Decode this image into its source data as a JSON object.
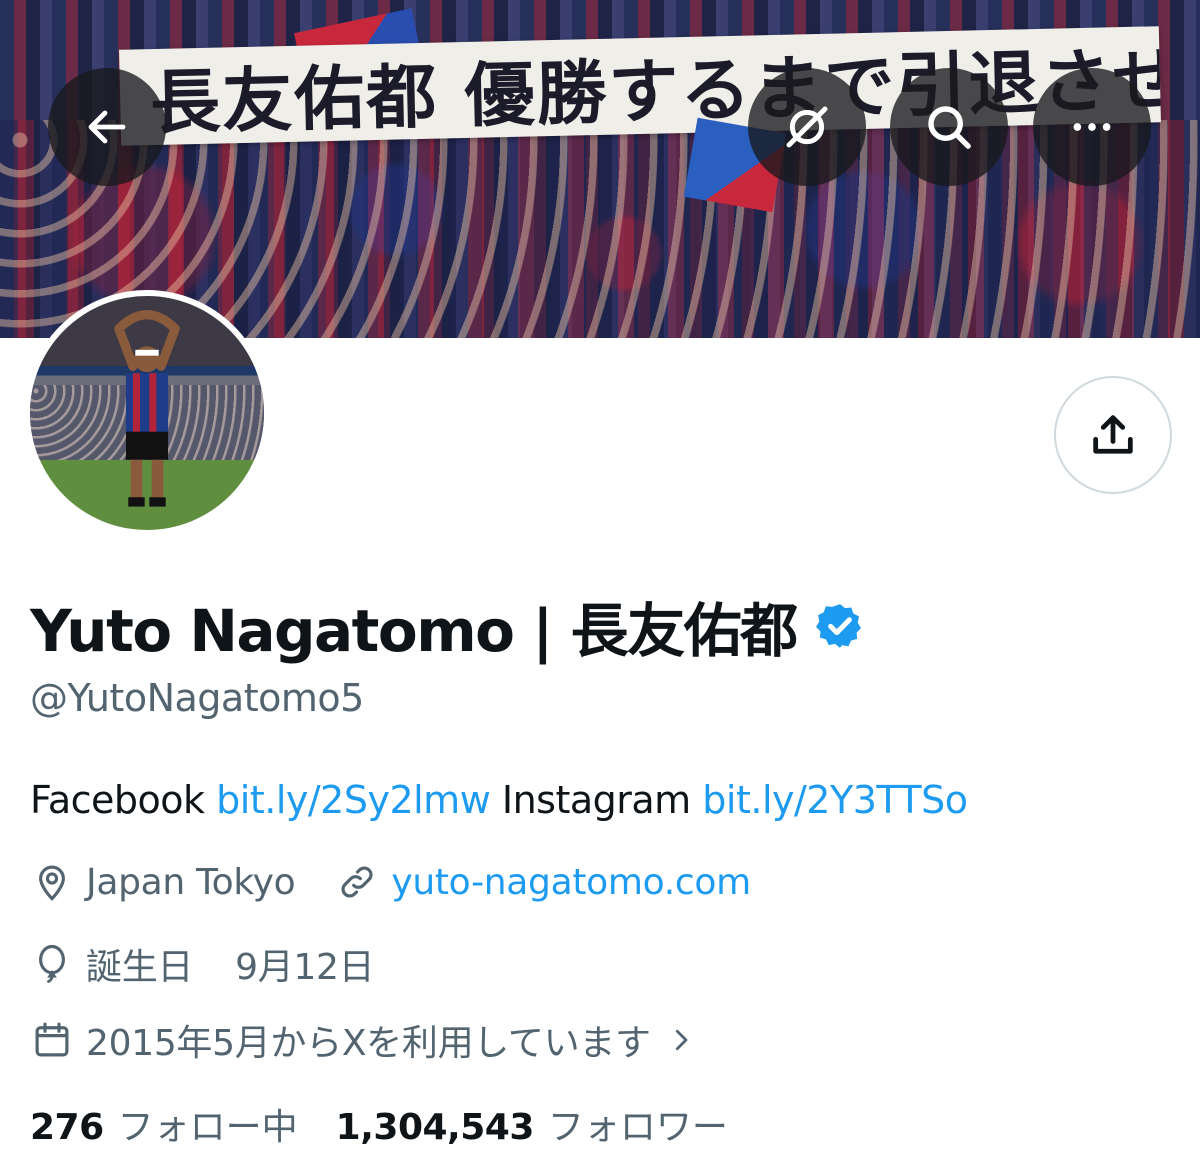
{
  "header": {
    "banner_sign_text": "長友佑都 優勝するまで引退させない"
  },
  "profile": {
    "display_name": "Yuto Nagatomo | 長友佑都",
    "handle": "@YutoNagatomo5",
    "verified": true,
    "bio": {
      "facebook_label": "Facebook",
      "facebook_link": "bit.ly/2Sy2lmw",
      "instagram_label": "Instagram",
      "instagram_link": "bit.ly/2Y3TTSo"
    },
    "location": "Japan Tokyo",
    "website": "yuto-nagatomo.com",
    "birthday_label": "誕生日",
    "birthday": "9月12日",
    "joined": "2015年5月からXを利用しています",
    "following_count": "276",
    "following_label": "フォロー中",
    "followers_count": "1,304,543",
    "followers_label": "フォロワー"
  },
  "icons": {
    "back": "arrow-left-icon",
    "grok": "grok-icon",
    "search": "search-icon",
    "more": "more-horizontal-icon",
    "share": "share-upload-icon",
    "verified": "verified-badge-icon",
    "location": "location-pin-icon",
    "link": "link-icon",
    "birthday": "balloon-icon",
    "calendar": "calendar-icon",
    "chevron": "chevron-right-icon"
  },
  "colors": {
    "link": "#1d9bf0",
    "secondary_text": "#536471",
    "primary_text": "#0f1419",
    "verified": "#1d9bf0"
  }
}
